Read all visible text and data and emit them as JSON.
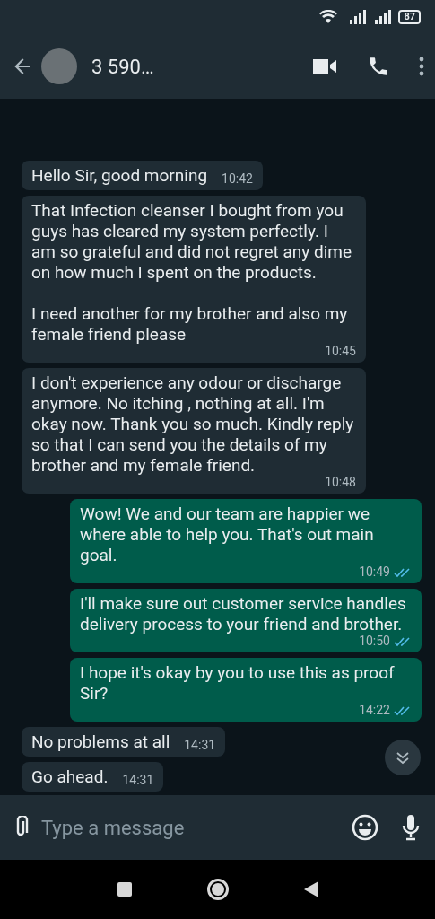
{
  "status_bar": {
    "battery": "87"
  },
  "header": {
    "title": "3 590…"
  },
  "messages": [
    {
      "kind": "incoming",
      "text": "Hello Sir, good morning",
      "time": "10:42"
    },
    {
      "kind": "incoming",
      "text": "That Infection cleanser I bought from you guys has cleared my system perfectly. I am so grateful and did not regret any dime on how much I spent on the products.\n\nI need another for my brother and also my female friend please",
      "time": "10:45"
    },
    {
      "kind": "incoming",
      "text": "I don't experience any odour or discharge anymore. No itching , nothing at all. I'm okay now. Thank you so much. Kindly reply so that I can send you the details of my brother and my female friend.",
      "time": "10:48"
    },
    {
      "kind": "outgoing",
      "text": "Wow! We and our team are happier we where able to help you. That's out main goal.",
      "time": "10:49",
      "read": true
    },
    {
      "kind": "outgoing",
      "text": "I'll make sure out customer service handles delivery process to your friend and brother.",
      "time": "10:50",
      "read": true
    },
    {
      "kind": "outgoing",
      "text": "I hope it's okay by you to use this as proof Sir?",
      "time": "14:22",
      "read": true
    },
    {
      "kind": "incoming",
      "text": "No problems at all",
      "time": "14:31"
    },
    {
      "kind": "incoming",
      "text": "Go ahead.",
      "time": "14:31"
    }
  ],
  "composer": {
    "placeholder": "Type a message"
  }
}
